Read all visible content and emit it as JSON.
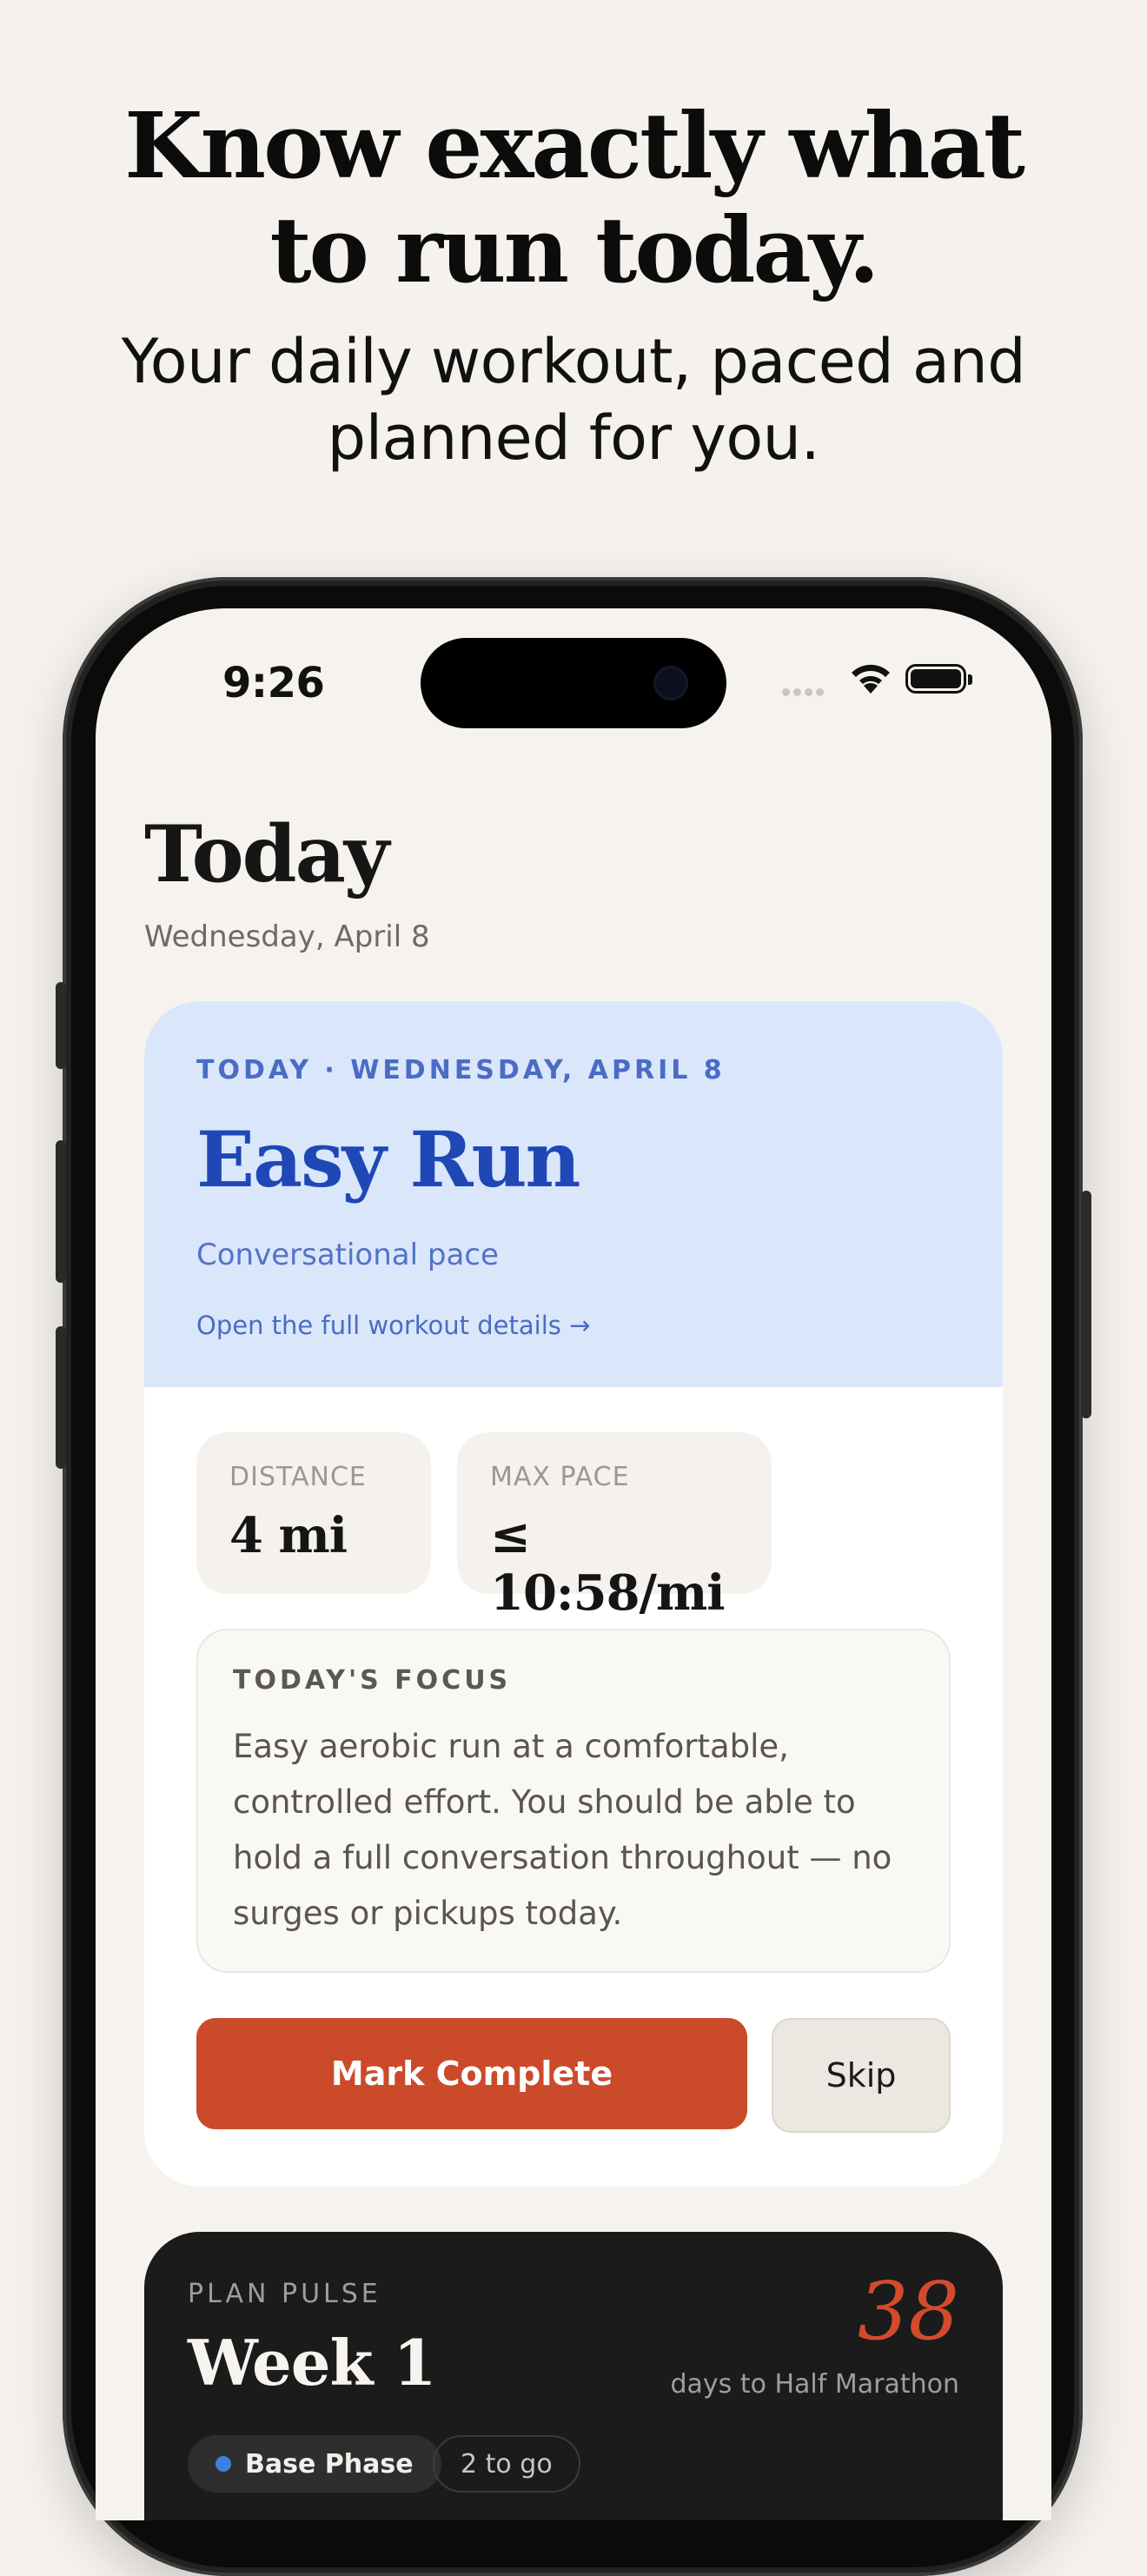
{
  "marketing": {
    "headline_line1": "Know exactly what",
    "headline_line2": "to run today.",
    "subline_line1": "Your daily workout, paced and",
    "subline_line2": "planned for you."
  },
  "status_bar": {
    "time": "9:26",
    "icons": [
      "signal-icon",
      "wifi-icon",
      "battery-icon"
    ]
  },
  "page": {
    "title": "Today",
    "date": "Wednesday, April 8"
  },
  "workout_card": {
    "eyebrow": "TODAY · WEDNESDAY, APRIL 8",
    "name": "Easy Run",
    "subtitle": "Conversational pace",
    "details_link": "Open the full workout details →",
    "stats": [
      {
        "label": "DISTANCE",
        "value": "4 mi"
      },
      {
        "label": "MAX PACE",
        "value": "≤ 10:58/mi"
      }
    ],
    "focus": {
      "label": "TODAY'S FOCUS",
      "text": "Easy aerobic run at a comfortable, controlled effort. You should be able to hold a full conversation throughout — no surges or pickups today."
    },
    "primary_action": "Mark Complete",
    "secondary_action": "Skip"
  },
  "plan_pulse": {
    "label": "PLAN PULSE",
    "week": "Week 1",
    "days_count": "38",
    "days_label": "days to Half Marathon",
    "chips": [
      "Base Phase",
      "2 to go"
    ]
  },
  "colors": {
    "background": "#f5f2ed",
    "hero_blue": "#dae7fb",
    "accent_blue": "#1f48b6",
    "accent_orange": "#cb4a2a",
    "dark_card": "#1b1b1b"
  }
}
